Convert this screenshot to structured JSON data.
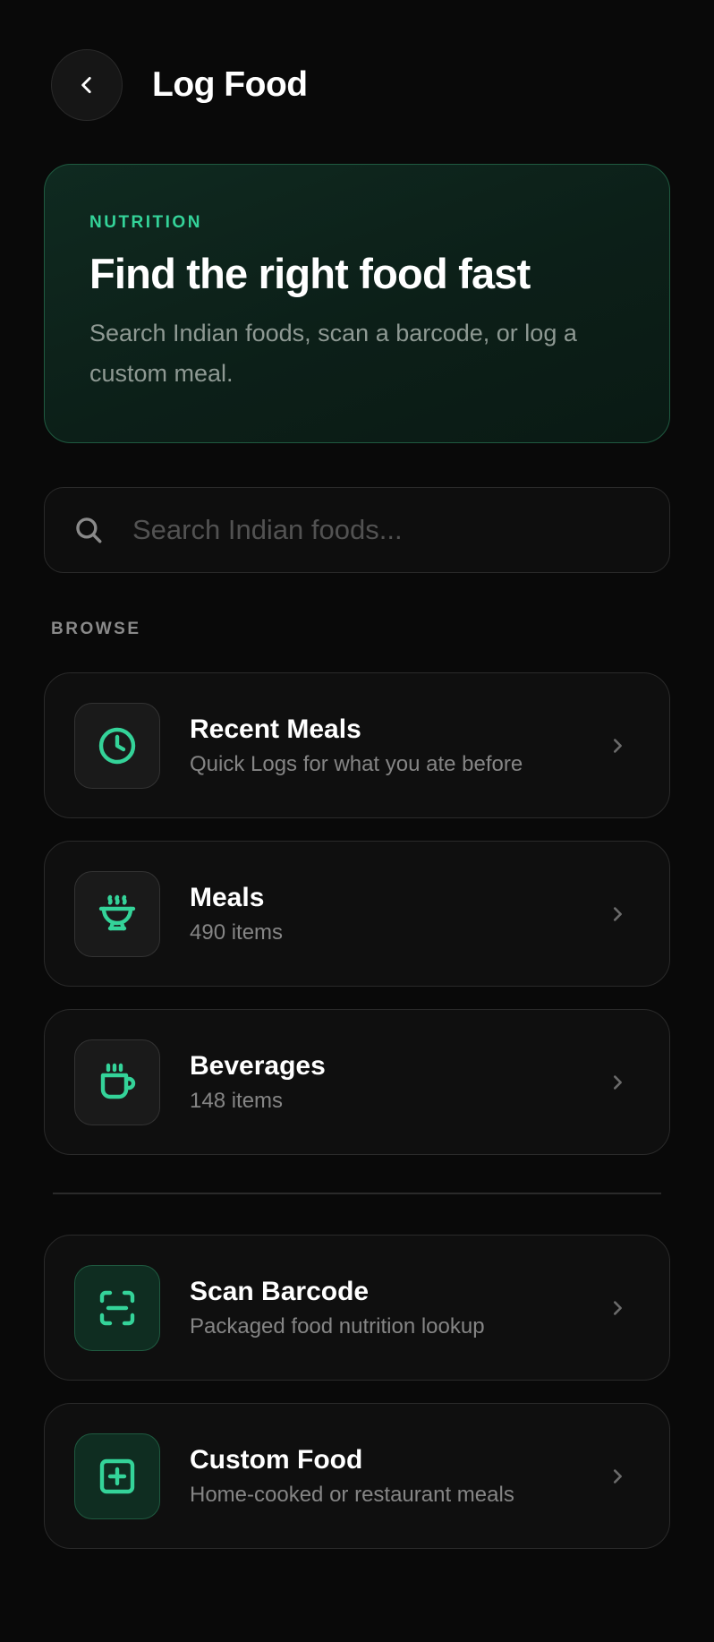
{
  "header": {
    "title": "Log Food",
    "back_icon": "chevron-left-icon"
  },
  "hero": {
    "eyebrow": "NUTRITION",
    "title": "Find the right food fast",
    "description": "Search Indian foods, scan a barcode, or log a custom meal."
  },
  "search": {
    "placeholder": "Search Indian foods...",
    "value": "",
    "icon": "search-icon"
  },
  "browse": {
    "label": "BROWSE",
    "items": [
      {
        "title": "Recent Meals",
        "subtitle": "Quick Logs for what you ate before",
        "icon": "clock-icon"
      },
      {
        "title": "Meals",
        "subtitle": "490 items",
        "icon": "bowl-icon"
      },
      {
        "title": "Beverages",
        "subtitle": "148 items",
        "icon": "cup-icon"
      }
    ]
  },
  "actions": {
    "items": [
      {
        "title": "Scan Barcode",
        "subtitle": "Packaged food nutrition lookup",
        "icon": "scan-icon"
      },
      {
        "title": "Custom Food",
        "subtitle": "Home-cooked or restaurant meals",
        "icon": "plus-square-icon"
      }
    ]
  },
  "colors": {
    "background": "#090909",
    "accent": "#34d399",
    "card": "#0f0f0f",
    "hero_bg": "#0f2a20"
  }
}
